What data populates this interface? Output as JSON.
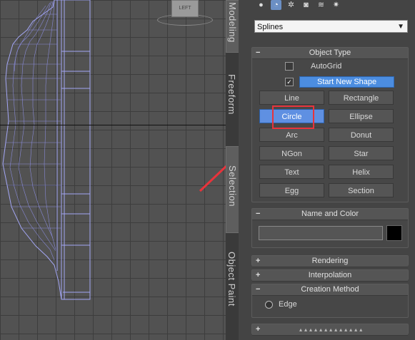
{
  "viewport": {
    "label": "LEFT"
  },
  "command_tabs": [
    {
      "label": "Modeling",
      "active": true
    },
    {
      "label": "Freeform",
      "active": false
    },
    {
      "label": "Selection",
      "active": true
    },
    {
      "label": "Object Paint",
      "active": false
    }
  ],
  "create_toolbar": {
    "icons": [
      "geometry-icon",
      "shapes-icon",
      "lights-icon",
      "cameras-icon",
      "helpers-icon",
      "systems-icon"
    ],
    "selected": "shapes-icon"
  },
  "category_dropdown": {
    "value": "Splines"
  },
  "object_type": {
    "header": "Object Type",
    "sign": "−",
    "autogrid_label": "AutoGrid",
    "autogrid_checked": false,
    "start_new_shape_checked": true,
    "start_new_shape_label": "Start New Shape",
    "buttons": [
      "Line",
      "Rectangle",
      "Circle",
      "Ellipse",
      "Arc",
      "Donut",
      "NGon",
      "Star",
      "Text",
      "Helix",
      "Egg",
      "Section"
    ],
    "active_button": "Circle"
  },
  "name_and_color": {
    "header": "Name and Color",
    "sign": "−",
    "name_value": "",
    "color": "#000000"
  },
  "rendering": {
    "header": "Rendering",
    "sign": "+"
  },
  "interpolation": {
    "header": "Interpolation",
    "sign": "+"
  },
  "creation_method": {
    "header": "Creation Method",
    "sign": "−",
    "option_label": "Edge"
  },
  "collapsed_bottom": {
    "sign": "+"
  },
  "colors": {
    "accent": "#4c8de0",
    "highlight": "#e8333b",
    "mesh": "#9a9cf0"
  }
}
